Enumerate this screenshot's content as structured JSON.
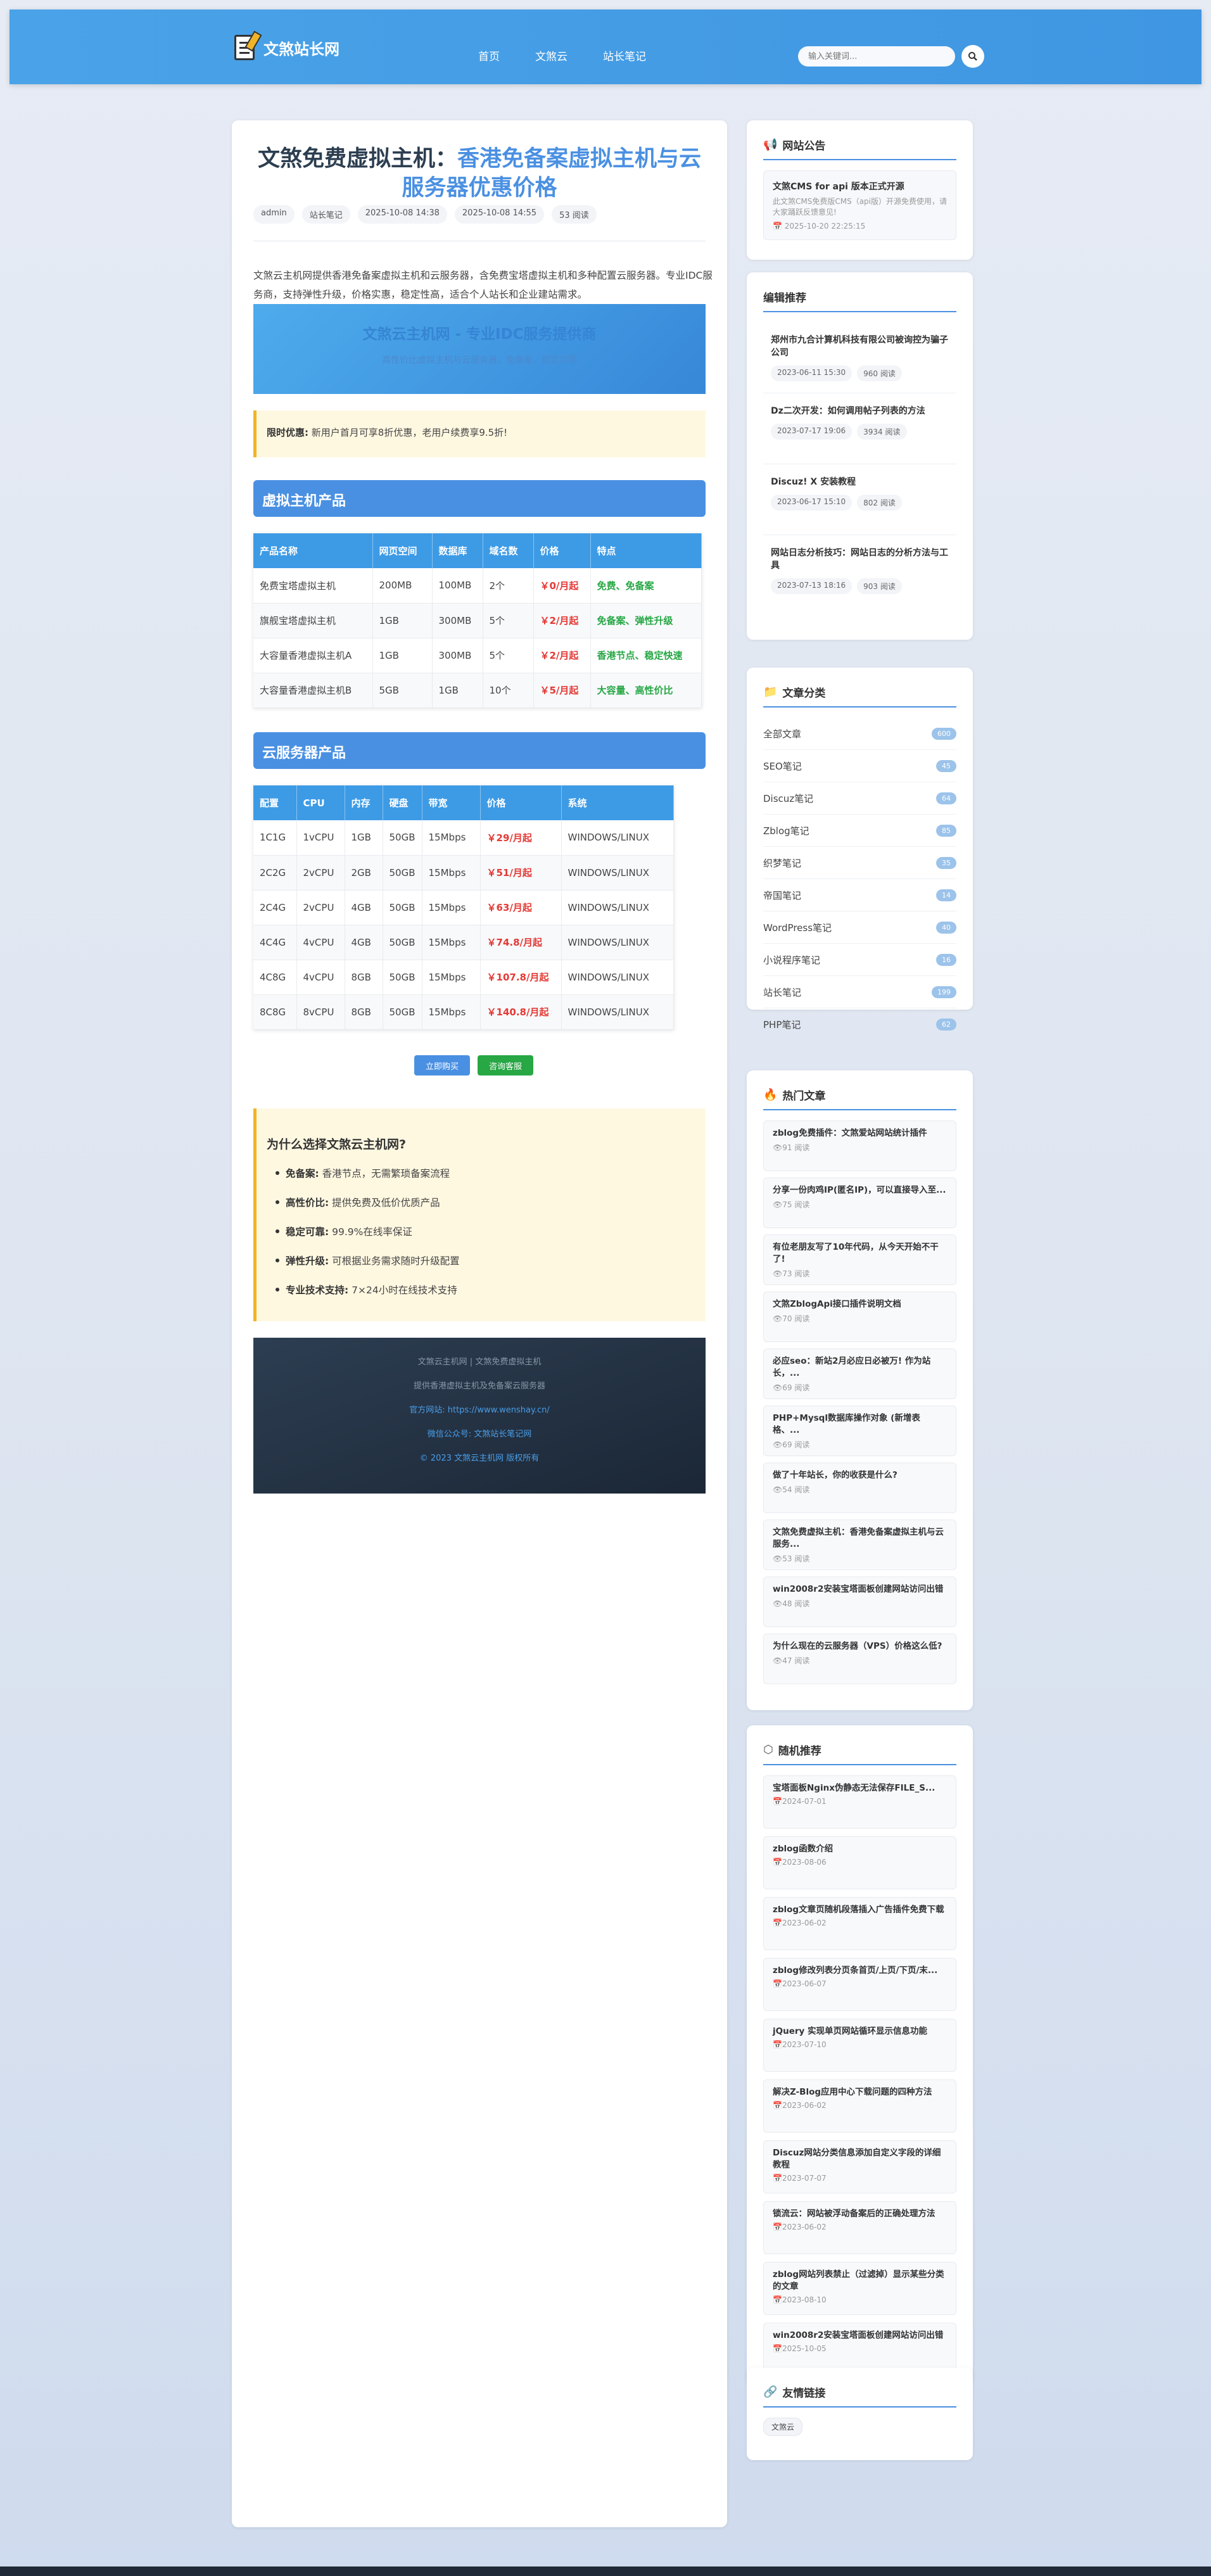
{
  "header": {
    "site_name": "文煞站长网",
    "nav": [
      "首页",
      "文煞云",
      "站长笔记"
    ],
    "search_placeholder": "输入关键词..."
  },
  "article": {
    "title_part1": "文煞免费虚拟主机：",
    "title_part2": "香港免备案虚拟主机与云服务器优惠价格",
    "meta": [
      "admin",
      "站长笔记",
      "2025-10-08 14:38",
      "2025-10-08 14:55",
      "53 阅读"
    ],
    "intro": "文煞云主机网提供香港免备案虚拟主机和云服务器，含免费宝塔虚拟主机和多种配置云服务器。专业IDC服务商，支持弹性升级，价格实惠，稳定性高，适合个人站长和企业建站需求。",
    "banner_title": "文煞云主机网 - 专业IDC服务提供商",
    "banner_sub": "高性价比虚拟主机与云服务器，免备案，稳定可靠",
    "notice_label": "限时优惠:",
    "notice_text": "新用户首月可享8折优惠，老用户续费享9.5折!",
    "vhost_title": "虚拟主机产品",
    "vhost_headers": [
      "产品名称",
      "网页空间",
      "数据库",
      "域名数",
      "价格",
      "特点"
    ],
    "vhost_rows": [
      [
        "免费宝塔虚拟主机",
        "200MB",
        "100MB",
        "2个",
        "￥0/月起",
        "免费、免备案"
      ],
      [
        "旗舰宝塔虚拟主机",
        "1GB",
        "300MB",
        "5个",
        "￥2/月起",
        "免备案、弹性升级"
      ],
      [
        "大容量香港虚拟主机A",
        "1GB",
        "300MB",
        "5个",
        "￥2/月起",
        "香港节点、稳定快速"
      ],
      [
        "大容量香港虚拟主机B",
        "5GB",
        "1GB",
        "10个",
        "￥5/月起",
        "大容量、高性价比"
      ]
    ],
    "cloud_title": "云服务器产品",
    "cloud_headers": [
      "配置",
      "CPU",
      "内存",
      "硬盘",
      "带宽",
      "价格",
      "系统"
    ],
    "cloud_rows": [
      [
        "1C1G",
        "1vCPU",
        "1GB",
        "50GB",
        "15Mbps",
        "￥29/月起",
        "WINDOWS/LINUX"
      ],
      [
        "2C2G",
        "2vCPU",
        "2GB",
        "50GB",
        "15Mbps",
        "￥51/月起",
        "WINDOWS/LINUX"
      ],
      [
        "2C4G",
        "2vCPU",
        "4GB",
        "50GB",
        "15Mbps",
        "￥63/月起",
        "WINDOWS/LINUX"
      ],
      [
        "4C4G",
        "4vCPU",
        "4GB",
        "50GB",
        "15Mbps",
        "￥74.8/月起",
        "WINDOWS/LINUX"
      ],
      [
        "4C8G",
        "4vCPU",
        "8GB",
        "50GB",
        "15Mbps",
        "￥107.8/月起",
        "WINDOWS/LINUX"
      ],
      [
        "8C8G",
        "8vCPU",
        "8GB",
        "50GB",
        "15Mbps",
        "￥140.8/月起",
        "WINDOWS/LINUX"
      ]
    ],
    "buy_label": "立即购买",
    "consult_label": "咨询客服",
    "why_title": "为什么选择文煞云主机网?",
    "why_items": [
      {
        "k": "免备案:",
        "v": "香港节点，无需繁琐备案流程"
      },
      {
        "k": "高性价比:",
        "v": "提供免费及低价优质产品"
      },
      {
        "k": "稳定可靠:",
        "v": "99.9%在线率保证"
      },
      {
        "k": "弹性升级:",
        "v": "可根据业务需求随时升级配置"
      },
      {
        "k": "专业技术支持:",
        "v": "7×24小时在线技术支持"
      }
    ],
    "footer_lines": [
      "文煞云主机网 | 文煞免费虚拟主机",
      "提供香港虚拟主机及免备案云服务器",
      "官方网站: https://www.wenshay.cn/",
      "微信公众号: 文煞站长笔记网",
      "© 2023 文煞云主机网 版权所有"
    ]
  },
  "sidebar": {
    "announce_title": "网站公告",
    "announce": {
      "title": "文煞CMS for api 版本正式开源",
      "desc": "此文煞CMS免费版CMS（api版）开源免费使用，请大家踊跃反馈意见!",
      "date": "2025-10-20 22:25:15"
    },
    "recommend_title": "编辑推荐",
    "recommend": [
      {
        "title": "郑州市九合计算机科技有限公司被询控为骗子公司",
        "date": "2023-06-11 15:30",
        "views": "960 阅读"
      },
      {
        "title": "Dz二次开发：如何调用帖子列表的方法",
        "date": "2023-07-17 19:06",
        "views": "3934 阅读"
      },
      {
        "title": "Discuz! X 安装教程",
        "date": "2023-06-17 15:10",
        "views": "802 阅读"
      },
      {
        "title": "网站日志分析技巧：网站日志的分析方法与工具",
        "date": "2023-07-13 18:16",
        "views": "903 阅读"
      }
    ],
    "category_title": "文章分类",
    "categories": [
      {
        "name": "全部文章",
        "count": "600"
      },
      {
        "name": "SEO笔记",
        "count": "45"
      },
      {
        "name": "Discuz笔记",
        "count": "64"
      },
      {
        "name": "Zblog笔记",
        "count": "85"
      },
      {
        "name": "织梦笔记",
        "count": "35"
      },
      {
        "name": "帝国笔记",
        "count": "14"
      },
      {
        "name": "WordPress笔记",
        "count": "40"
      },
      {
        "name": "小说程序笔记",
        "count": "16"
      },
      {
        "name": "站长笔记",
        "count": "199"
      },
      {
        "name": "PHP笔记",
        "count": "62"
      }
    ],
    "hot_title": "热门文章",
    "hot": [
      {
        "title": "zblog免费插件：文煞爱站网站统计插件",
        "views": "91 阅读"
      },
      {
        "title": "分享一份肉鸡IP(匿名IP)，可以直接导入至...",
        "views": "75 阅读"
      },
      {
        "title": "有位老朋友写了10年代码，从今天开始不干了!",
        "views": "73 阅读"
      },
      {
        "title": "文煞ZblogApi接口插件说明文档",
        "views": "70 阅读"
      },
      {
        "title": "必应seo：新站2月必应日必被万! 作为站长，...",
        "views": "69 阅读"
      },
      {
        "title": "PHP+Mysql数据库操作对象 (新增表格、...",
        "views": "69 阅读"
      },
      {
        "title": "做了十年站长，你的收获是什么?",
        "views": "54 阅读"
      },
      {
        "title": "文煞免费虚拟主机：香港免备案虚拟主机与云服务...",
        "views": "53 阅读"
      },
      {
        "title": "win2008r2安装宝塔面板创建网站访问出错",
        "views": "48 阅读"
      },
      {
        "title": "为什么现在的云服务器（VPS）价格这么低?",
        "views": "47 阅读"
      }
    ],
    "random_title": "随机推荐",
    "random": [
      {
        "title": "宝塔面板Nginx伪静态无法保存FILE_S...",
        "date": "2024-07-01"
      },
      {
        "title": "zblog函数介绍",
        "date": "2023-08-06"
      },
      {
        "title": "zblog文章页随机段落插入广告插件免费下载",
        "date": "2023-06-02"
      },
      {
        "title": "zblog修改列表分页条首页/上页/下页/末...",
        "date": "2023-06-07"
      },
      {
        "title": "jQuery 实现单页网站循环显示信息功能",
        "date": "2023-07-10"
      },
      {
        "title": "解决Z-Blog应用中心下载问题的四种方法",
        "date": "2023-06-02"
      },
      {
        "title": "Discuz网站分类信息添加自定义字段的详细教程",
        "date": "2023-07-07"
      },
      {
        "title": "锁流云：网站被浮动备案后的正确处理方法",
        "date": "2023-06-02"
      },
      {
        "title": "zblog网站列表禁止（过滤掉）显示某些分类的文章",
        "date": "2023-08-10"
      },
      {
        "title": "win2008r2安装宝塔面板创建网站访问出错",
        "date": "2025-10-05"
      }
    ],
    "links_title": "友情链接",
    "links": [
      "文煞云"
    ]
  },
  "colors": {
    "primary": "#4a90e2",
    "header": "#3f96e2",
    "price": "#e53935",
    "feature": "#27a745",
    "notice_border": "#f0b429"
  }
}
